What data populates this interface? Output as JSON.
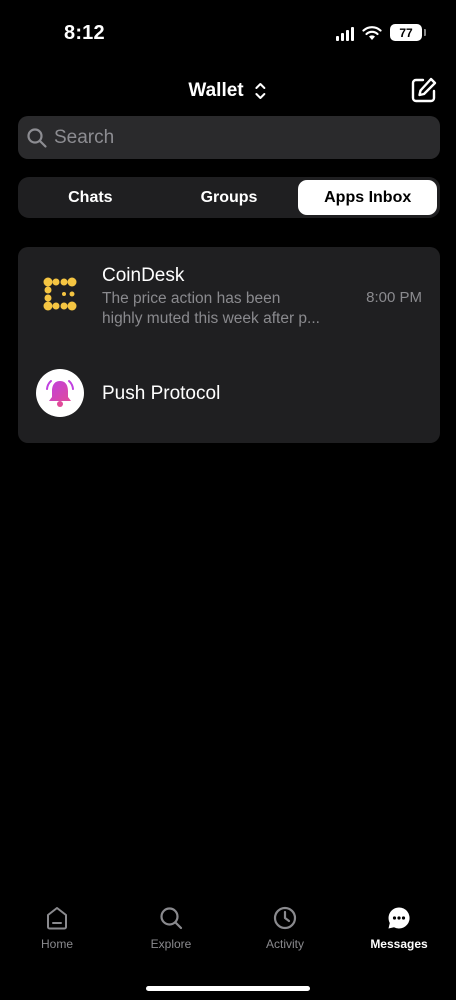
{
  "status_bar": {
    "time": "8:12",
    "battery": "77"
  },
  "header": {
    "title": "Wallet"
  },
  "search": {
    "placeholder": "Search"
  },
  "tabs": [
    {
      "label": "Chats",
      "active": false
    },
    {
      "label": "Groups",
      "active": false
    },
    {
      "label": "Apps Inbox",
      "active": true
    }
  ],
  "inbox": [
    {
      "name": "CoinDesk",
      "preview_line1": "The price action has been",
      "preview_line2": "highly muted this week after p...",
      "time": "8:00 PM",
      "icon": "coindesk-logo-icon"
    },
    {
      "name": "Push Protocol",
      "icon": "push-protocol-bell-icon"
    }
  ],
  "nav": [
    {
      "label": "Home",
      "icon": "home-icon",
      "active": false
    },
    {
      "label": "Explore",
      "icon": "search-icon",
      "active": false
    },
    {
      "label": "Activity",
      "icon": "clock-icon",
      "active": false
    },
    {
      "label": "Messages",
      "icon": "chat-bubble-icon",
      "active": true
    }
  ],
  "colors": {
    "background": "#000000",
    "surface": "#1f1f21",
    "search_bg": "#2a2a2c",
    "muted_text": "#8a8a8e",
    "coindesk_yellow": "#f5c542",
    "push_purple": "#c040e0",
    "push_pink": "#e04a9a"
  }
}
